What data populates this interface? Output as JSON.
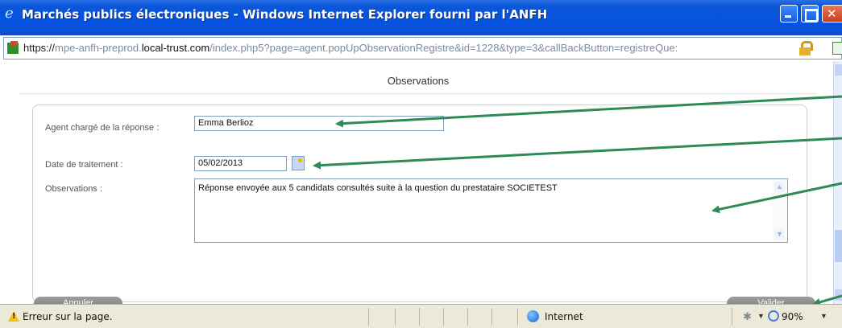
{
  "window": {
    "title": "Marchés publics électroniques - Windows Internet Explorer fourni par l'ANFH",
    "minimize_label": "",
    "maximize_label": "",
    "close_label": ""
  },
  "address": {
    "protocol": "https://",
    "pre": "mpe-anfh-preprod.",
    "domain": "local-trust.com",
    "path": "/index.php5?page=agent.popUpObservationRegistre&id=1228&type=3&callBackButton=registreQue:"
  },
  "dialog": {
    "title": "Observations",
    "agent_label": "Agent chargé de la réponse :",
    "agent_value": "Emma Berlioz",
    "date_label": "Date de traitement :",
    "date_value": "05/02/2013",
    "observations_label": "Observations :",
    "observations_value": "Réponse envoyée aux 5 candidats consultés suite à la question du prestataire SOCIETEST",
    "cancel_label": "Annuler",
    "submit_label": "Valider"
  },
  "statusbar": {
    "message": "Erreur sur la page.",
    "zone": "Internet",
    "zoom": "90%"
  },
  "colors": {
    "titlebar": "#0554e0",
    "annotation_arrow": "#2e8b57",
    "button_grey": "#8c8c8c"
  },
  "icons": [
    "ie-icon",
    "anfh-favicon",
    "lock-icon",
    "page-icon",
    "calendar-icon",
    "warning-icon",
    "globe-icon",
    "protected-mode-icon",
    "zoom-icon"
  ]
}
